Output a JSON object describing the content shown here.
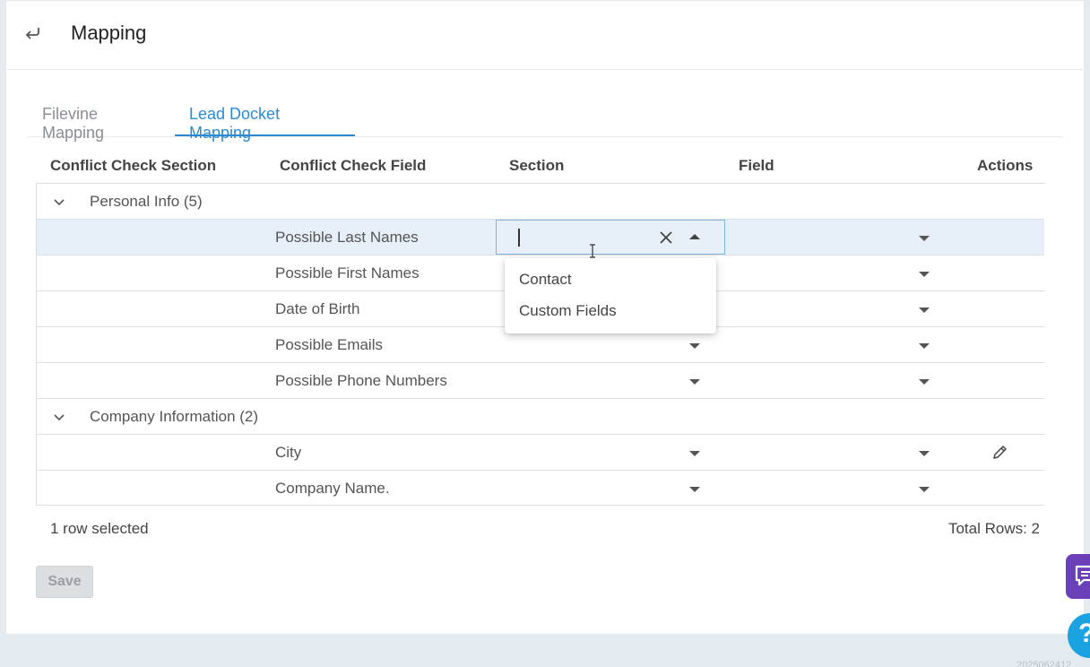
{
  "header": {
    "title": "Mapping"
  },
  "tabs": [
    {
      "label": "Filevine Mapping",
      "active": false
    },
    {
      "label": "Lead Docket Mapping",
      "active": true
    }
  ],
  "columns": [
    "Conflict Check Section",
    "Conflict Check Field",
    "Section",
    "Field",
    "Actions"
  ],
  "groups": [
    {
      "label": "Personal Info (5)",
      "rows": [
        "Possible Last Names",
        "Possible First Names",
        "Date of Birth",
        "Possible Emails",
        "Possible Phone Numbers"
      ]
    },
    {
      "label": "Company Information (2)",
      "rows": [
        "City",
        "Company Name."
      ]
    }
  ],
  "dropdown": {
    "options": [
      "Contact",
      "Custom Fields"
    ]
  },
  "footer": {
    "selected_text": "1 row selected",
    "total_text": "Total Rows: 2"
  },
  "save_label": "Save",
  "help_label": "?",
  "bottom_text": "2025062412",
  "colors": {
    "accent": "#2b8ad2",
    "selected_row": "#e7eff8",
    "chat": "#6b3fb8",
    "help": "#1aa3e0"
  }
}
